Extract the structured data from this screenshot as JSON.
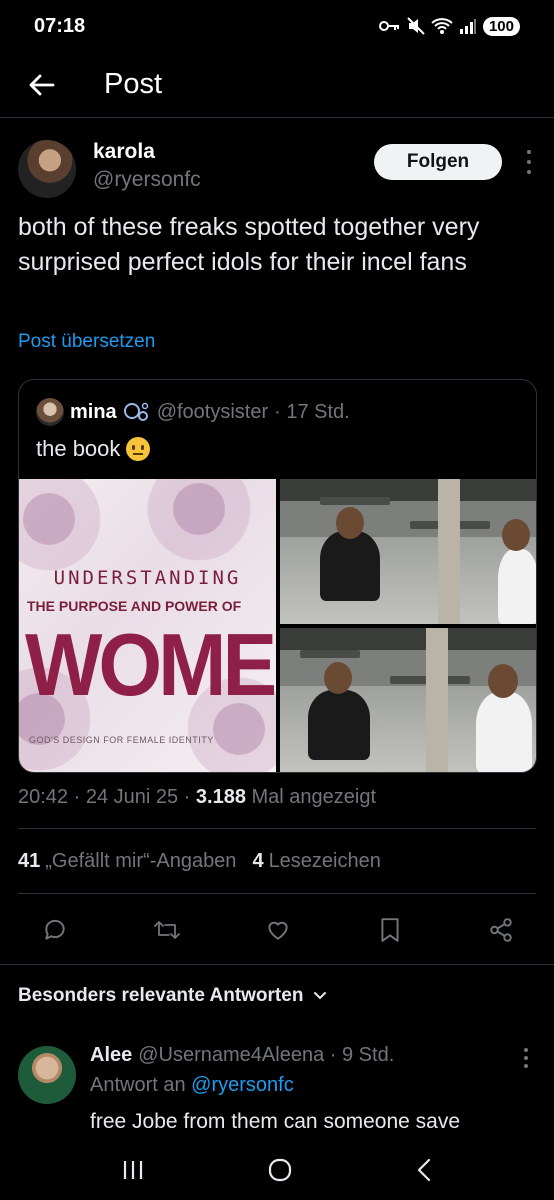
{
  "status_bar": {
    "time": "07:18",
    "battery": "100"
  },
  "header": {
    "title": "Post"
  },
  "author": {
    "name": "karola",
    "handle": "@ryersonfc",
    "follow_label": "Folgen"
  },
  "post": {
    "text": "both of these freaks spotted together very surprised perfect idols for their incel fans",
    "translate_label": "Post übersetzen"
  },
  "quote": {
    "name": "mina",
    "handle": "@footysister",
    "time": "· 17 Std.",
    "text": "the book",
    "book": {
      "line1": "UNDERSTANDING",
      "line2": "THE PURPOSE AND POWER OF",
      "title": "WOMEN",
      "subtitle": "GOD'S DESIGN FOR FEMALE IDENTITY"
    }
  },
  "meta": {
    "time": "20:42 · 24 Juni 25 · ",
    "views": "3.188",
    "views_label": " Mal angezeigt"
  },
  "stats": {
    "likes": "41",
    "likes_label": "„Gefällt mir“-Angaben",
    "bookmarks": "4",
    "bookmarks_label": "Lesezeichen"
  },
  "actions": [
    "reply-icon",
    "repost-icon",
    "like-icon",
    "bookmark-icon",
    "share-icon"
  ],
  "replies": {
    "section_title": "Besonders relevante Antworten",
    "items": [
      {
        "name": "Alee",
        "handle": "@Username4Aleena",
        "time": "· 9 Std.",
        "reply_to_label": "Antwort an",
        "reply_to": "@ryersonfc",
        "text": "free Jobe from them can someone save"
      }
    ]
  },
  "colors": {
    "accent": "#1d9bf0",
    "text": "#e7e9ea",
    "muted": "#71767b",
    "background": "#000000"
  }
}
